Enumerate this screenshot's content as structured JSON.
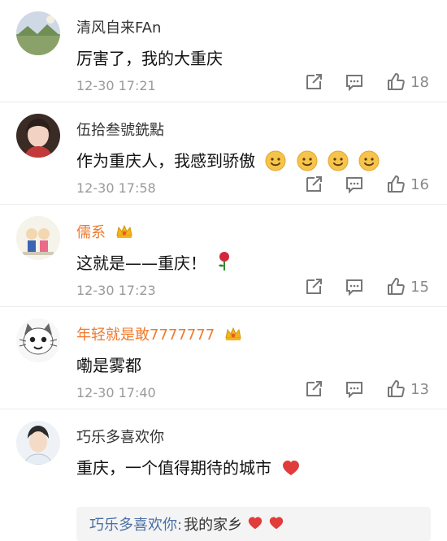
{
  "comments": [
    {
      "user": "清风自来FAn",
      "vip": false,
      "text": "厉害了，我的大重庆",
      "time": "12-30 17:21",
      "likes": "18",
      "avatar_icon": "landscape-icon",
      "emojis": []
    },
    {
      "user": "伍拾叁號銑點",
      "vip": false,
      "text": "作为重庆人，我感到骄傲",
      "time": "12-30 17:58",
      "likes": "16",
      "avatar_icon": "person-icon",
      "emojis": [
        "smile-emoji",
        "smile-emoji",
        "smile-emoji",
        "smile-emoji"
      ]
    },
    {
      "user": "儒系",
      "vip": true,
      "text": "这就是——重庆！",
      "time": "12-30 17:23",
      "likes": "15",
      "avatar_icon": "cartoon-icon",
      "emojis": [
        "rose-emoji"
      ]
    },
    {
      "user": "年轻就是敢7777777",
      "vip": true,
      "text": "嘞是雾都",
      "time": "12-30 17:40",
      "likes": "13",
      "avatar_icon": "cat-icon",
      "emojis": []
    },
    {
      "user": "巧乐多喜欢你",
      "vip": false,
      "text": "重庆，一个值得期待的城市",
      "time": "",
      "likes": "",
      "avatar_icon": "person-icon",
      "emojis": [
        "heart-emoji"
      ],
      "reply": {
        "name": "巧乐多喜欢你:",
        "text": "我的家乡",
        "emojis": [
          "heart-emoji",
          "heart-emoji"
        ]
      }
    }
  ],
  "colors": {
    "vip_name": "#f07a2c",
    "reply_name": "#4a6fa5"
  }
}
